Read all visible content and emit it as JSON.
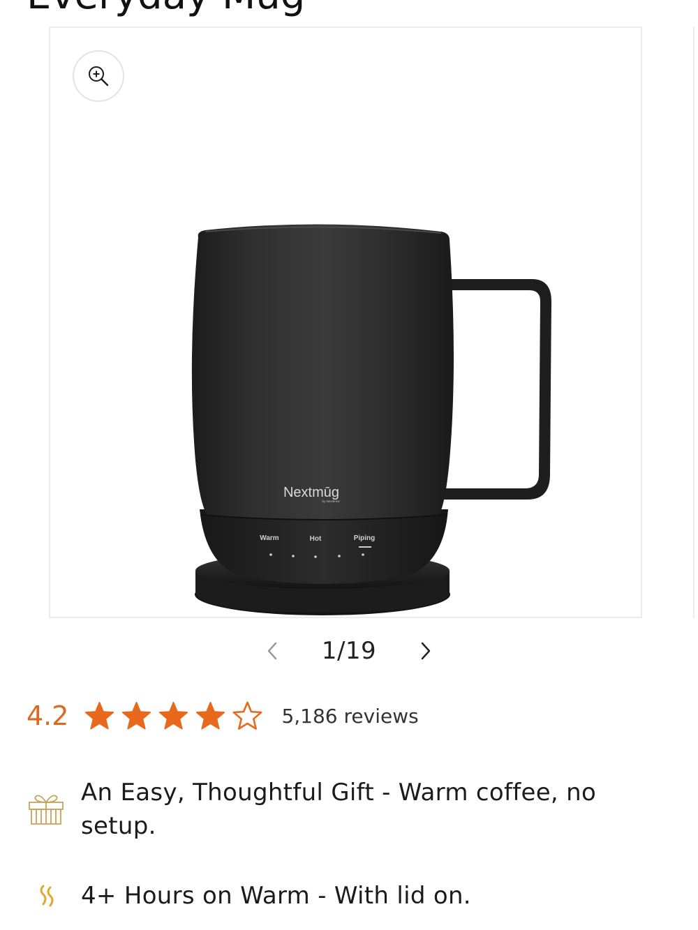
{
  "product": {
    "title": "Everyday Mug"
  },
  "gallery": {
    "zoom_icon": "zoom-in-icon",
    "current_index": 1,
    "total": 19,
    "counter": "1/19",
    "prev_icon": "chevron-left-icon",
    "next_icon": "chevron-right-icon",
    "image": {
      "brand_text": "Nextmūg",
      "brand_sub": "by Nextbrew",
      "settings": [
        "Warm",
        "Hot",
        "Piping"
      ],
      "selected_setting": "Piping"
    }
  },
  "rating": {
    "value": "4.2",
    "stars_filled": 4,
    "stars_total": 5,
    "reviews_label": "5,186 reviews",
    "star_color": "#e8691b",
    "value_color": "#d96a1f"
  },
  "features": [
    {
      "icon": "gift-icon",
      "text": "An Easy, Thoughtful Gift - Warm coffee, no setup."
    },
    {
      "icon": "heat-waves-icon",
      "text": "4+ Hours on Warm - With lid on."
    }
  ]
}
